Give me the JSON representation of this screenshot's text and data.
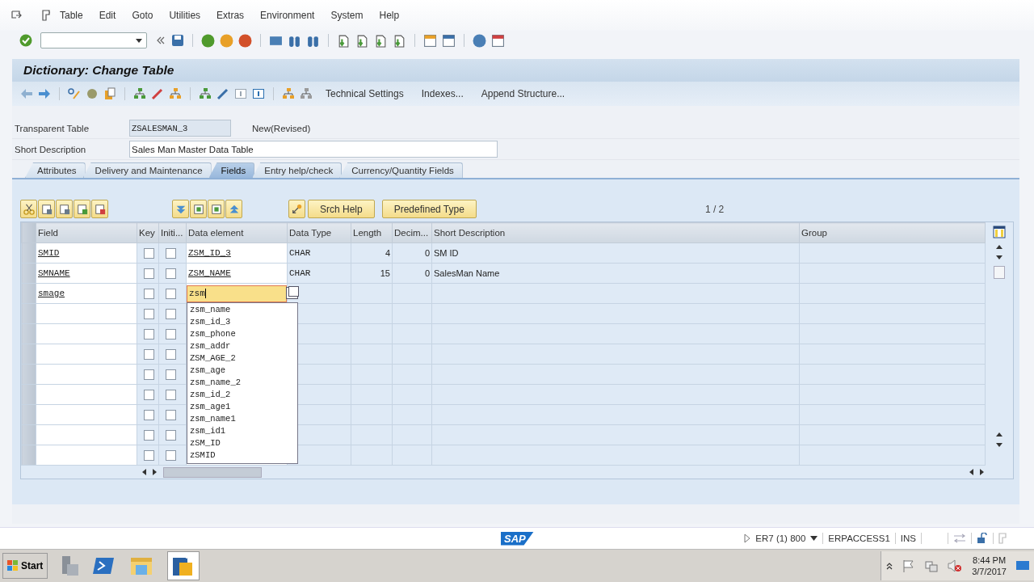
{
  "menu_bar": [
    "Table",
    "Edit",
    "Goto",
    "Utilities",
    "Extras",
    "Environment",
    "System",
    "Help"
  ],
  "title": "Dictionary: Change Table",
  "app_toolbar_buttons": [
    "Technical Settings",
    "Indexes...",
    "Append Structure..."
  ],
  "transparent_table": {
    "label": "Transparent Table",
    "value": "ZSALESMAN_3",
    "status": "New(Revised)"
  },
  "short_description": {
    "label": "Short Description",
    "value": "Sales Man Master Data Table"
  },
  "tabs": [
    {
      "label": "Attributes",
      "selected": false
    },
    {
      "label": "Delivery and Maintenance",
      "selected": false
    },
    {
      "label": "Fields",
      "selected": true
    },
    {
      "label": "Entry help/check",
      "selected": false
    },
    {
      "label": "Currency/Quantity Fields",
      "selected": false
    }
  ],
  "table_toolbar": {
    "buttons": [
      "Srch Help",
      "Predefined Type"
    ],
    "page": "1 / 2"
  },
  "table": {
    "columns": [
      "Field",
      "Key",
      "Initi...",
      "Data element",
      "Data Type",
      "Length",
      "Decim...",
      "Short Description",
      "Group"
    ],
    "rows": [
      {
        "field": "SMID",
        "key": false,
        "initial": false,
        "data_element": "ZSM_ID_3",
        "data_type": "CHAR",
        "length": "4",
        "decimals": "0",
        "short_description": "SM ID",
        "active": false
      },
      {
        "field": "SMNAME",
        "key": false,
        "initial": false,
        "data_element": "ZSM_NAME",
        "data_type": "CHAR",
        "length": "15",
        "decimals": "0",
        "short_description": "SalesMan Name",
        "active": false
      },
      {
        "field": "smage",
        "key": false,
        "initial": false,
        "data_element": "zsm",
        "active": true
      },
      {
        "key": false,
        "initial": false,
        "active": false
      },
      {
        "key": false,
        "initial": false,
        "active": false
      },
      {
        "key": false,
        "initial": false,
        "active": false
      },
      {
        "key": false,
        "initial": false,
        "active": false
      },
      {
        "key": false,
        "initial": false,
        "active": false
      },
      {
        "key": false,
        "initial": false,
        "active": false
      },
      {
        "key": false,
        "initial": false,
        "active": false
      },
      {
        "key": false,
        "initial": false,
        "active": false
      }
    ]
  },
  "autocomplete": [
    "zsm_name",
    "zsm_id_3",
    "zsm_phone",
    "zsm_addr",
    "ZSM_AGE_2",
    "zsm_age",
    "zsm_name_2",
    "zsm_id_2",
    "zsm_age1",
    "zsm_name1",
    "zsm_id1",
    "zSM_ID",
    "zSMID"
  ],
  "logo": "SAP",
  "status_bar": {
    "system": "ER7 (1) 800",
    "server": "ERPACCESS1",
    "mode": "INS"
  },
  "taskbar": {
    "start": "Start",
    "time": "8:44 PM",
    "date": "3/7/2017"
  }
}
